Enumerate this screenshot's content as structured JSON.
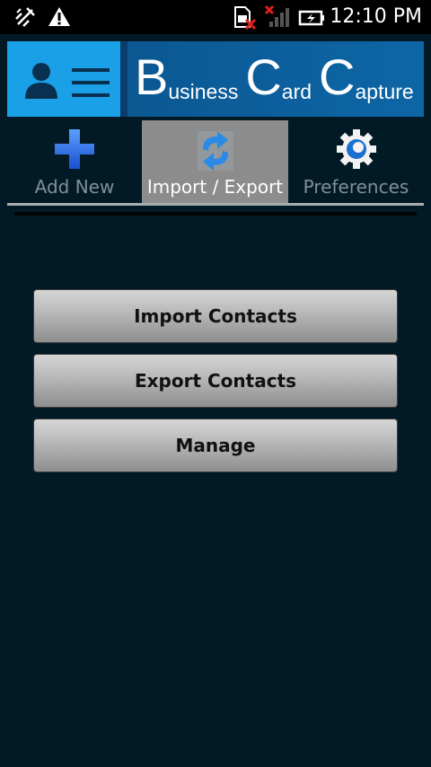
{
  "status_bar": {
    "time": "12:10 PM",
    "icons": [
      "usb-debug-icon",
      "warning-icon",
      "no-sim-icon",
      "no-signal-icon",
      "battery-charging-icon"
    ]
  },
  "banner": {
    "logo_icon": "contact-card-icon",
    "title_parts": [
      {
        "big": "B",
        "small": "usiness"
      },
      {
        "big": "C",
        "small": "ard"
      },
      {
        "big": "C",
        "small": "apture"
      }
    ]
  },
  "tabs": [
    {
      "label": "Add New",
      "icon": "plus-icon",
      "active": false
    },
    {
      "label": "Import / Export",
      "icon": "sync-arrows-icon",
      "active": true
    },
    {
      "label": "Preferences",
      "icon": "gear-icon",
      "active": false
    }
  ],
  "actions": {
    "import_label": "Import Contacts",
    "export_label": "Export Contacts",
    "manage_label": "Manage"
  },
  "colors": {
    "background": "#021a26",
    "banner": "#0b5a95",
    "logo_bg": "#1aa0e6",
    "active_tab": "#8c8c8c"
  }
}
